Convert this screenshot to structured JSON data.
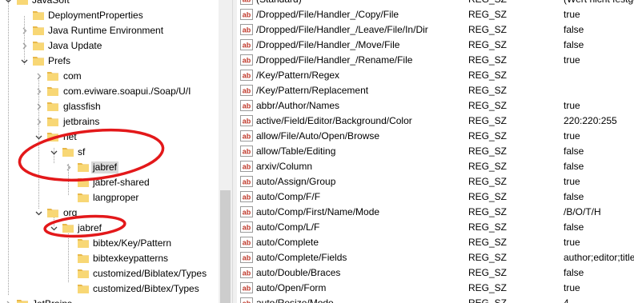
{
  "tree": {
    "nodes": [
      {
        "label": "JavaSoft",
        "level": 1,
        "expanded": true,
        "has_children": true,
        "selected": false
      },
      {
        "label": "DeploymentProperties",
        "level": 2,
        "expanded": false,
        "has_children": false,
        "selected": false
      },
      {
        "label": "Java Runtime Environment",
        "level": 2,
        "expanded": false,
        "has_children": true,
        "selected": false
      },
      {
        "label": "Java Update",
        "level": 2,
        "expanded": false,
        "has_children": true,
        "selected": false
      },
      {
        "label": "Prefs",
        "level": 2,
        "expanded": true,
        "has_children": true,
        "selected": false
      },
      {
        "label": "com",
        "level": 3,
        "expanded": false,
        "has_children": true,
        "selected": false
      },
      {
        "label": "com.eviware.soapui./Soap/U/I",
        "level": 3,
        "expanded": false,
        "has_children": true,
        "selected": false
      },
      {
        "label": "glassfish",
        "level": 3,
        "expanded": false,
        "has_children": true,
        "selected": false
      },
      {
        "label": "jetbrains",
        "level": 3,
        "expanded": false,
        "has_children": true,
        "selected": false
      },
      {
        "label": "net",
        "level": 3,
        "expanded": true,
        "has_children": true,
        "selected": false
      },
      {
        "label": "sf",
        "level": 4,
        "expanded": true,
        "has_children": true,
        "selected": false
      },
      {
        "label": "jabref",
        "level": 5,
        "expanded": false,
        "has_children": true,
        "selected": true
      },
      {
        "label": "jabref-shared",
        "level": 5,
        "expanded": false,
        "has_children": false,
        "selected": false
      },
      {
        "label": "langproper",
        "level": 5,
        "expanded": false,
        "has_children": false,
        "selected": false
      },
      {
        "label": "org",
        "level": 3,
        "expanded": true,
        "has_children": true,
        "selected": false
      },
      {
        "label": "jabref",
        "level": 4,
        "expanded": true,
        "has_children": true,
        "selected": false
      },
      {
        "label": "bibtex/Key/Pattern",
        "level": 5,
        "expanded": false,
        "has_children": false,
        "selected": false
      },
      {
        "label": "bibtexkeypatterns",
        "level": 5,
        "expanded": false,
        "has_children": false,
        "selected": false
      },
      {
        "label": "customized/Biblatex/Types",
        "level": 5,
        "expanded": false,
        "has_children": false,
        "selected": false
      },
      {
        "label": "customized/Bibtex/Types",
        "level": 5,
        "expanded": false,
        "has_children": false,
        "selected": false
      },
      {
        "label": "JetBrains",
        "level": 1,
        "expanded": false,
        "has_children": true,
        "selected": false
      }
    ]
  },
  "values": {
    "rows": [
      {
        "name": "(Standard)",
        "type": "REG_SZ",
        "data": "(Wert nicht festgelegt)"
      },
      {
        "name": "/Dropped/File/Handler_/Copy/File",
        "type": "REG_SZ",
        "data": "true"
      },
      {
        "name": "/Dropped/File/Handler_/Leave/File/In/Dir",
        "type": "REG_SZ",
        "data": "false"
      },
      {
        "name": "/Dropped/File/Handler_/Move/File",
        "type": "REG_SZ",
        "data": "false"
      },
      {
        "name": "/Dropped/File/Handler_/Rename/File",
        "type": "REG_SZ",
        "data": "true"
      },
      {
        "name": "/Key/Pattern/Regex",
        "type": "REG_SZ",
        "data": ""
      },
      {
        "name": "/Key/Pattern/Replacement",
        "type": "REG_SZ",
        "data": ""
      },
      {
        "name": "abbr/Author/Names",
        "type": "REG_SZ",
        "data": "true"
      },
      {
        "name": "active/Field/Editor/Background/Color",
        "type": "REG_SZ",
        "data": "220:220:255"
      },
      {
        "name": "allow/File/Auto/Open/Browse",
        "type": "REG_SZ",
        "data": "true"
      },
      {
        "name": "allow/Table/Editing",
        "type": "REG_SZ",
        "data": "false"
      },
      {
        "name": "arxiv/Column",
        "type": "REG_SZ",
        "data": "false"
      },
      {
        "name": "auto/Assign/Group",
        "type": "REG_SZ",
        "data": "true"
      },
      {
        "name": "auto/Comp/F/F",
        "type": "REG_SZ",
        "data": "false"
      },
      {
        "name": "auto/Comp/First/Name/Mode",
        "type": "REG_SZ",
        "data": "/B/O/T/H"
      },
      {
        "name": "auto/Comp/L/F",
        "type": "REG_SZ",
        "data": "false"
      },
      {
        "name": "auto/Complete",
        "type": "REG_SZ",
        "data": "true"
      },
      {
        "name": "auto/Complete/Fields",
        "type": "REG_SZ",
        "data": "author;editor;title;journal;publisher;keywords"
      },
      {
        "name": "auto/Double/Braces",
        "type": "REG_SZ",
        "data": "false"
      },
      {
        "name": "auto/Open/Form",
        "type": "REG_SZ",
        "data": "true"
      },
      {
        "name": "auto/Resize/Mode",
        "type": "REG_SZ",
        "data": "4"
      }
    ]
  },
  "icons": {
    "folder": "folder-icon",
    "string_value": "string-value-icon"
  },
  "colors": {
    "folder_fill": "#f8d775",
    "folder_tab": "#e8b84a",
    "selection": "#d9d9d9",
    "annotation_ellipse": "#e3181a",
    "ab_icon_red": "#c0392b",
    "guide_line": "#a0a0a0"
  }
}
